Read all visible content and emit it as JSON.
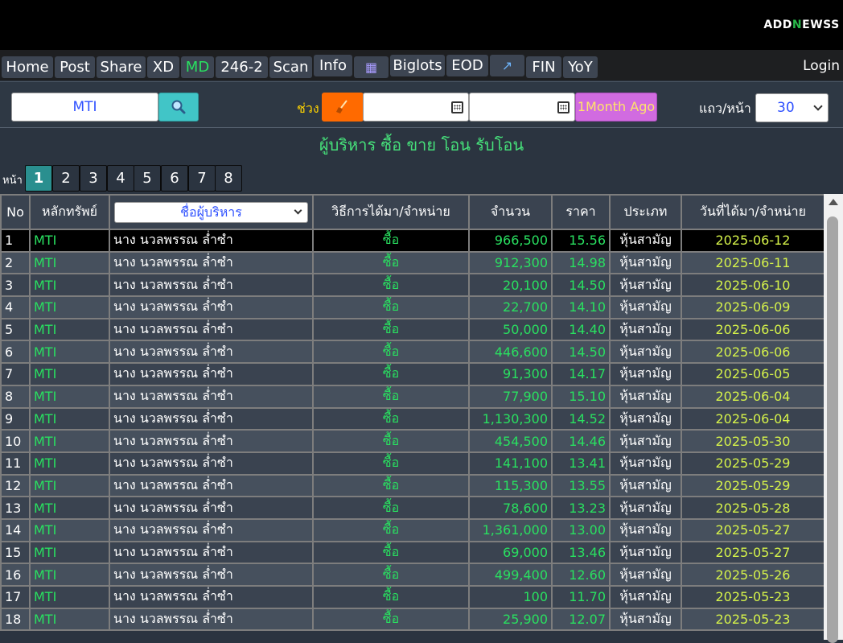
{
  "logo": {
    "part1": "ADD",
    "part2": "N",
    "part3": "EWSS"
  },
  "nav": {
    "items": [
      {
        "label": "Home"
      },
      {
        "label": "Post"
      },
      {
        "label": "Share"
      },
      {
        "label": "XD"
      },
      {
        "label": "MD"
      },
      {
        "label": "246-2"
      },
      {
        "label": "Scan"
      },
      {
        "label": "Info"
      },
      {
        "label": "▦"
      },
      {
        "label": "Biglots"
      },
      {
        "label": "EOD"
      },
      {
        "label": "↗"
      },
      {
        "label": "FIN"
      },
      {
        "label": "YoY"
      }
    ],
    "active": "MD",
    "login": "Login"
  },
  "toolbar": {
    "search_value": "MTI",
    "range_label": "ช่วง",
    "month_button": "1Month Ago",
    "rows_label": "แถว/หน้า",
    "rows_value": "30"
  },
  "page_title": "ผู้บริหาร ซื้อ ขาย โอน รับโอน",
  "pager": {
    "label": "หน้า",
    "pages": [
      "1",
      "2",
      "3",
      "4",
      "5",
      "6",
      "7",
      "8"
    ],
    "active": "1"
  },
  "table": {
    "headers": {
      "no": "No",
      "symbol": "หลักทรัพย์",
      "name": "ชื่อผู้บริหาร",
      "method": "วิธีการได้มา/จำหน่าย",
      "qty": "จำนวน",
      "price": "ราคา",
      "type": "ประเภท",
      "date": "วันที่ได้มา/จำหน่าย"
    },
    "rows": [
      {
        "no": "1",
        "symbol": "MTI",
        "name": "นาง นวลพรรณ ล่ำซำ",
        "method": "ซื้อ",
        "qty": "966,500",
        "price": "15.56",
        "type": "หุ้นสามัญ",
        "date": "2025-06-12"
      },
      {
        "no": "2",
        "symbol": "MTI",
        "name": "นาง นวลพรรณ ล่ำซำ",
        "method": "ซื้อ",
        "qty": "912,300",
        "price": "14.98",
        "type": "หุ้นสามัญ",
        "date": "2025-06-11"
      },
      {
        "no": "3",
        "symbol": "MTI",
        "name": "นาง นวลพรรณ ล่ำซำ",
        "method": "ซื้อ",
        "qty": "20,100",
        "price": "14.50",
        "type": "หุ้นสามัญ",
        "date": "2025-06-10"
      },
      {
        "no": "4",
        "symbol": "MTI",
        "name": "นาง นวลพรรณ ล่ำซำ",
        "method": "ซื้อ",
        "qty": "22,700",
        "price": "14.10",
        "type": "หุ้นสามัญ",
        "date": "2025-06-09"
      },
      {
        "no": "5",
        "symbol": "MTI",
        "name": "นาง นวลพรรณ ล่ำซำ",
        "method": "ซื้อ",
        "qty": "50,000",
        "price": "14.40",
        "type": "หุ้นสามัญ",
        "date": "2025-06-06"
      },
      {
        "no": "6",
        "symbol": "MTI",
        "name": "นาง นวลพรรณ ล่ำซำ",
        "method": "ซื้อ",
        "qty": "446,600",
        "price": "14.50",
        "type": "หุ้นสามัญ",
        "date": "2025-06-06"
      },
      {
        "no": "7",
        "symbol": "MTI",
        "name": "นาง นวลพรรณ ล่ำซำ",
        "method": "ซื้อ",
        "qty": "91,300",
        "price": "14.17",
        "type": "หุ้นสามัญ",
        "date": "2025-06-05"
      },
      {
        "no": "8",
        "symbol": "MTI",
        "name": "นาง นวลพรรณ ล่ำซำ",
        "method": "ซื้อ",
        "qty": "77,900",
        "price": "15.10",
        "type": "หุ้นสามัญ",
        "date": "2025-06-04"
      },
      {
        "no": "9",
        "symbol": "MTI",
        "name": "นาง นวลพรรณ ล่ำซำ",
        "method": "ซื้อ",
        "qty": "1,130,300",
        "price": "14.52",
        "type": "หุ้นสามัญ",
        "date": "2025-06-04"
      },
      {
        "no": "10",
        "symbol": "MTI",
        "name": "นาง นวลพรรณ ล่ำซำ",
        "method": "ซื้อ",
        "qty": "454,500",
        "price": "14.46",
        "type": "หุ้นสามัญ",
        "date": "2025-05-30"
      },
      {
        "no": "11",
        "symbol": "MTI",
        "name": "นาง นวลพรรณ ล่ำซำ",
        "method": "ซื้อ",
        "qty": "141,100",
        "price": "13.41",
        "type": "หุ้นสามัญ",
        "date": "2025-05-29"
      },
      {
        "no": "12",
        "symbol": "MTI",
        "name": "นาง นวลพรรณ ล่ำซำ",
        "method": "ซื้อ",
        "qty": "115,300",
        "price": "13.55",
        "type": "หุ้นสามัญ",
        "date": "2025-05-29"
      },
      {
        "no": "13",
        "symbol": "MTI",
        "name": "นาง นวลพรรณ ล่ำซำ",
        "method": "ซื้อ",
        "qty": "78,600",
        "price": "13.23",
        "type": "หุ้นสามัญ",
        "date": "2025-05-28"
      },
      {
        "no": "14",
        "symbol": "MTI",
        "name": "นาง นวลพรรณ ล่ำซำ",
        "method": "ซื้อ",
        "qty": "1,361,000",
        "price": "13.00",
        "type": "หุ้นสามัญ",
        "date": "2025-05-27"
      },
      {
        "no": "15",
        "symbol": "MTI",
        "name": "นาง นวลพรรณ ล่ำซำ",
        "method": "ซื้อ",
        "qty": "69,000",
        "price": "13.46",
        "type": "หุ้นสามัญ",
        "date": "2025-05-27"
      },
      {
        "no": "16",
        "symbol": "MTI",
        "name": "นาง นวลพรรณ ล่ำซำ",
        "method": "ซื้อ",
        "qty": "499,400",
        "price": "12.60",
        "type": "หุ้นสามัญ",
        "date": "2025-05-26"
      },
      {
        "no": "17",
        "symbol": "MTI",
        "name": "นาง นวลพรรณ ล่ำซำ",
        "method": "ซื้อ",
        "qty": "100",
        "price": "11.70",
        "type": "หุ้นสามัญ",
        "date": "2025-05-23"
      },
      {
        "no": "18",
        "symbol": "MTI",
        "name": "นาง นวลพรรณ ล่ำซำ",
        "method": "ซื้อ",
        "qty": "25,900",
        "price": "12.07",
        "type": "หุ้นสามัญ",
        "date": "2025-05-23"
      }
    ]
  }
}
